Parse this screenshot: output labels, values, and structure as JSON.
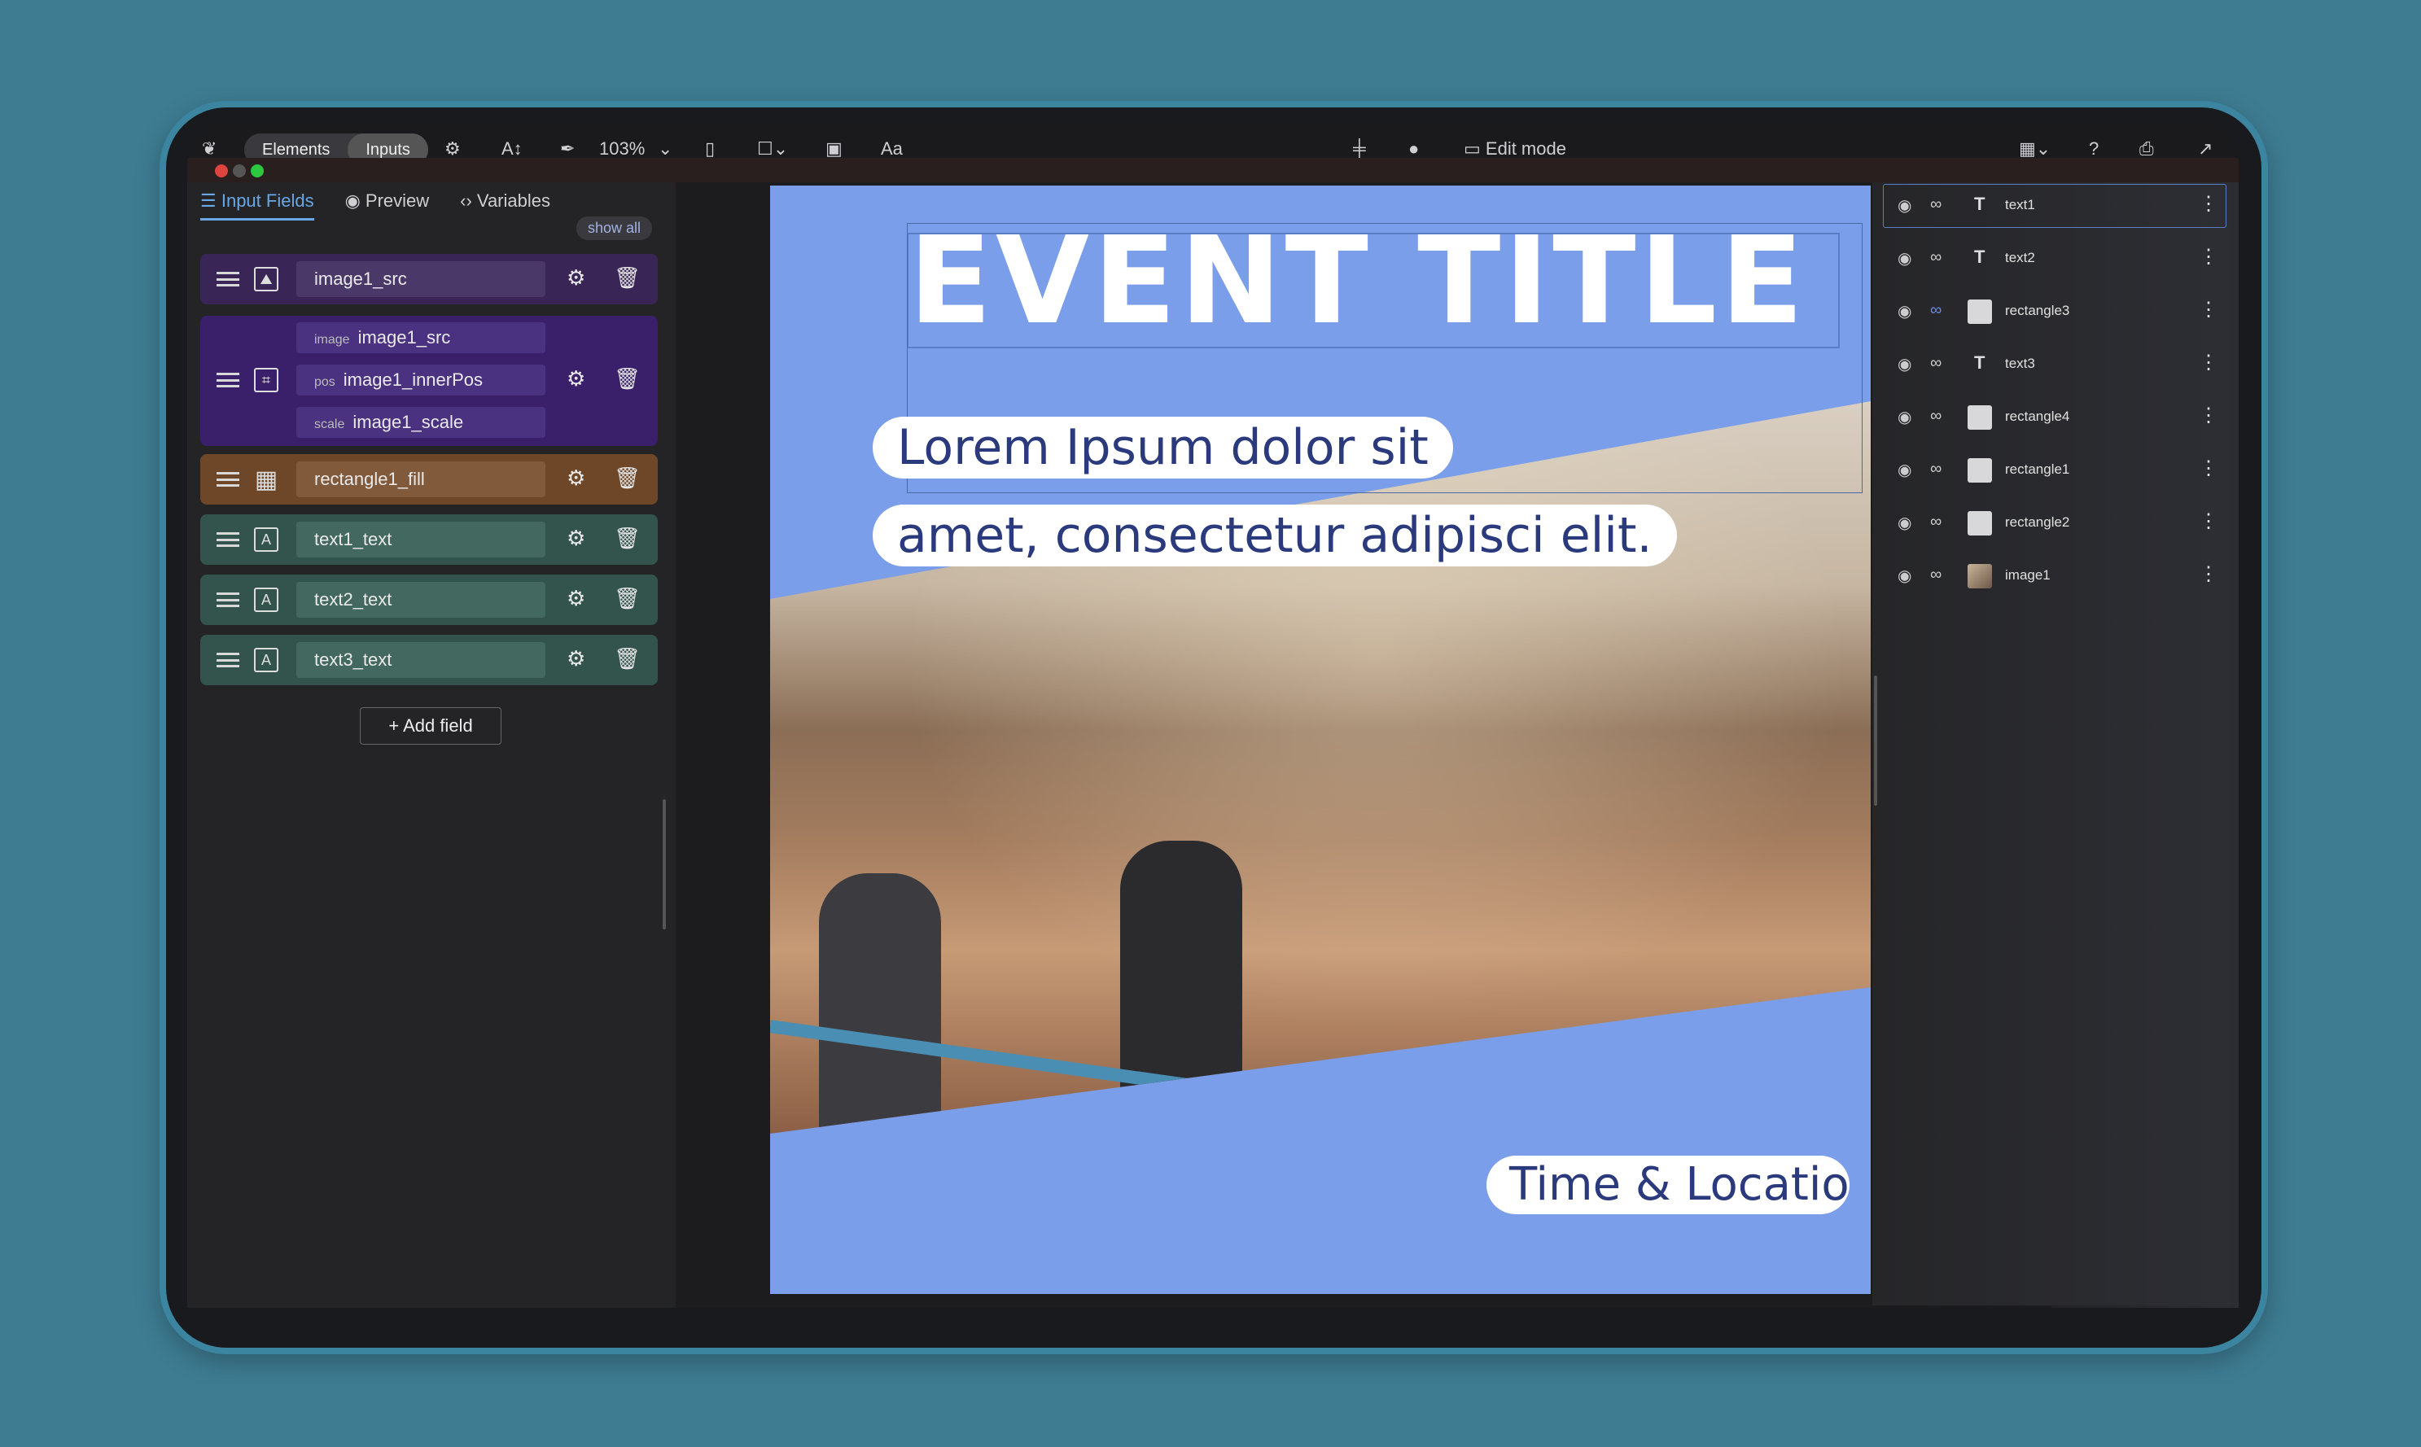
{
  "toolbar": {
    "mode_elements": "Elements",
    "mode_inputs": "Inputs",
    "zoom": "103%",
    "text_tool": "Aa",
    "edit_mode": "Edit mode",
    "help": "?"
  },
  "left_panel": {
    "tabs": [
      "Input Fields",
      "Preview",
      "Variables"
    ],
    "show_all": "show all",
    "fields": [
      {
        "label": "image1_src"
      },
      {
        "sub": [
          {
            "prefix": "image",
            "label": "image1_src"
          },
          {
            "prefix": "pos",
            "label": "image1_innerPos"
          },
          {
            "prefix": "scale",
            "label": "image1_scale"
          }
        ]
      },
      {
        "label": "rectangle1_fill"
      },
      {
        "label": "text1_text"
      },
      {
        "label": "text2_text"
      },
      {
        "label": "text3_text"
      }
    ],
    "add_field": "Add field"
  },
  "canvas": {
    "title": "EVENT TITLE",
    "line1": "Lorem Ipsum dolor sit",
    "line2": "amet, consectetur adipisci elit.",
    "time_location": "Time & Locatio"
  },
  "layers": [
    {
      "name": "text1",
      "kind": "T"
    },
    {
      "name": "text2",
      "kind": "T"
    },
    {
      "name": "rectangle3",
      "kind": "rect"
    },
    {
      "name": "text3",
      "kind": "T"
    },
    {
      "name": "rectangle4",
      "kind": "rect"
    },
    {
      "name": "rectangle1",
      "kind": "rect"
    },
    {
      "name": "rectangle2",
      "kind": "rect"
    },
    {
      "name": "image1",
      "kind": "image"
    }
  ],
  "colors": {
    "background": "#3e7c92",
    "artboard": "#7b9eea",
    "accent": "#6aa7e6",
    "field_purple": "#4a2a6e",
    "field_brown": "#7a5030",
    "field_green": "#3d5c55"
  }
}
